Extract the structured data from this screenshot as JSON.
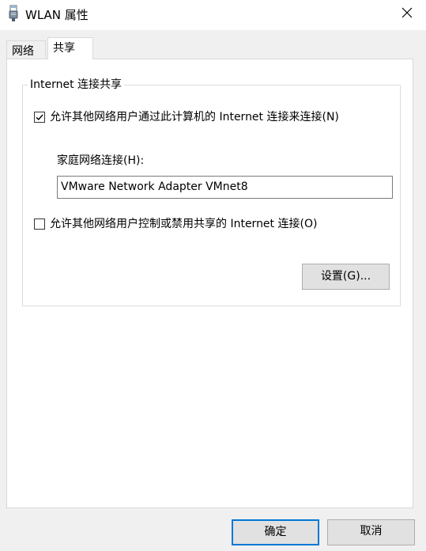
{
  "window": {
    "title": "WLAN 属性"
  },
  "tabs": [
    {
      "label": "网络"
    },
    {
      "label": "共享"
    }
  ],
  "ics": {
    "group_title": "Internet 连接共享",
    "allow_connect": {
      "label": "允许其他网络用户通过此计算机的 Internet 连接来连接(N)",
      "checked": true
    },
    "home_network_label": "家庭网络连接(H):",
    "home_network_value": "VMware Network Adapter VMnet8",
    "allow_control": {
      "label": "允许其他网络用户控制或禁用共享的 Internet 连接(O)",
      "checked": false
    },
    "settings_label": "设置(G)..."
  },
  "footer": {
    "ok_label": "确定",
    "cancel_label": "取消"
  },
  "icons": {
    "title": "network-adapter-icon",
    "close": "close-icon",
    "check": "checkmark-icon"
  },
  "colors": {
    "accent": "#0078d7",
    "window_bg": "#f0f0f0",
    "panel_bg": "#ffffff"
  }
}
